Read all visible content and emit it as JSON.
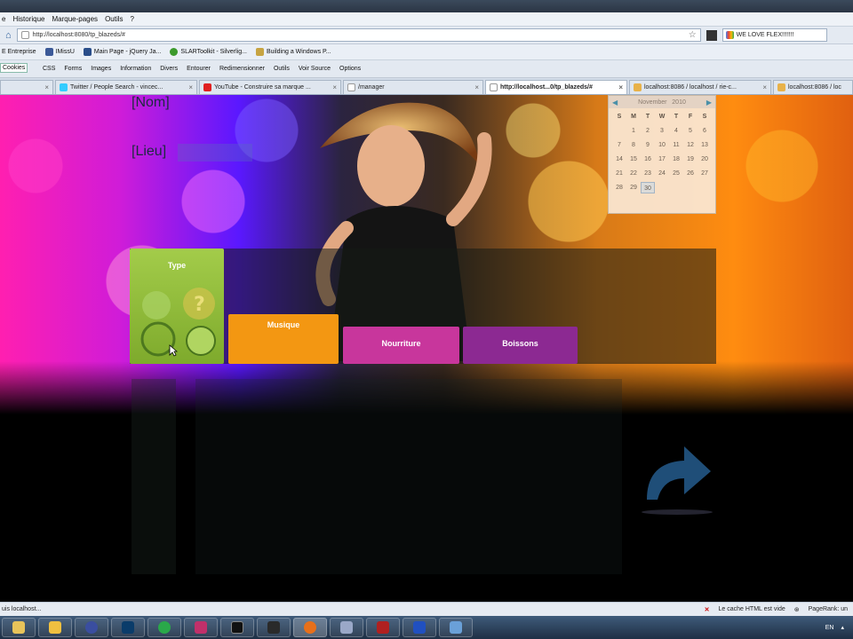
{
  "menubar": {
    "items": [
      "e",
      "Historique",
      "Marque-pages",
      "Outils",
      "?"
    ]
  },
  "nav": {
    "url": "http://localhost:8080/tp_blazeds/#",
    "search_value": "WE LOVE FLEX!!!!!!!"
  },
  "bookmarks": [
    "E Entreprise",
    "IMissU",
    "Main Page - jQuery Ja...",
    "SLARToolkit - Silverlig...",
    "Building a Windows P..."
  ],
  "toolbar2": [
    "Cookies",
    "CSS",
    "Forms",
    "Images",
    "Information",
    "Divers",
    "Entourer",
    "Redimensionner",
    "Outils",
    "Voir Source",
    "Options"
  ],
  "tabs": [
    {
      "label": "Twitter / People Search - vincec...",
      "active": false
    },
    {
      "label": "YouTube - Construire sa marque ...",
      "active": false
    },
    {
      "label": "/manager",
      "active": false
    },
    {
      "label": "http://localhost...0/tp_blazeds/#",
      "active": true
    },
    {
      "label": "localhost:8086 / localhost / rie-c...",
      "active": false
    },
    {
      "label": "localhost:8086 / loc",
      "active": false
    }
  ],
  "form": {
    "nom_label": "[Nom]",
    "lieu_label": "[Lieu]"
  },
  "calendar": {
    "month": "November",
    "year": "2010",
    "days_of_week": [
      "S",
      "M",
      "T",
      "W",
      "T",
      "F",
      "S"
    ],
    "weeks": [
      [
        "",
        "1",
        "2",
        "3",
        "4",
        "5",
        "6"
      ],
      [
        "7",
        "8",
        "9",
        "10",
        "11",
        "12",
        "13"
      ],
      [
        "14",
        "15",
        "16",
        "17",
        "18",
        "19",
        "20"
      ],
      [
        "21",
        "22",
        "23",
        "24",
        "25",
        "26",
        "27"
      ],
      [
        "28",
        "29",
        "30",
        "",
        "",
        "",
        ""
      ]
    ],
    "selected_day": "30"
  },
  "tiles": {
    "type": "Type",
    "musique": "Musique",
    "nourriture": "Nourriture",
    "boissons": "Boissons"
  },
  "status": {
    "left": "uis localhost...",
    "cache": "Le cache HTML est vide",
    "pagerank": "PageRank: un"
  },
  "taskbar": {
    "lang": "EN"
  },
  "colors": {
    "type_tile": "#8fbb3a",
    "musique_tile": "#f39712",
    "nourriture_tile": "#c8369c",
    "boissons_tile": "#8c2992",
    "share_arrow": "#1f4e78"
  }
}
